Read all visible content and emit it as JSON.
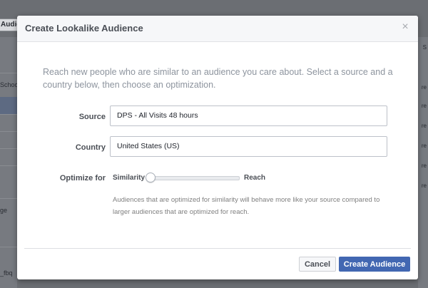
{
  "background": {
    "tab_label": "Audie",
    "left_texts": [
      "Schoo",
      "ge",
      "_fbq"
    ],
    "right_texts": [
      "S",
      "re",
      "re",
      "re",
      "re",
      "re",
      "re"
    ]
  },
  "dialog": {
    "title": "Create Lookalike Audience",
    "close_glyph": "×",
    "intro": "Reach new people who are similar to an audience you care about. Select a source and a country below, then choose an optimization.",
    "source": {
      "label": "Source",
      "value": "DPS - All Visits 48 hours"
    },
    "country": {
      "label": "Country",
      "value": "United States (US)"
    },
    "optimize": {
      "label": "Optimize for",
      "min_label": "Similarity",
      "max_label": "Reach",
      "level": 0
    },
    "help_text": "Audiences that are optimized for similarity will behave more like your source compared to larger audiences that are optimized for reach.",
    "cancel_label": "Cancel",
    "create_label": "Create Audience"
  },
  "colors": {
    "primary": "#4267b2",
    "overlay": "#6b6e73"
  }
}
